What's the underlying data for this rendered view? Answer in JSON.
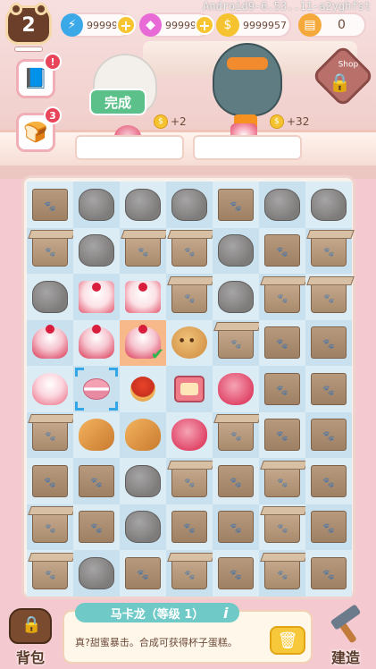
{
  "debug_text": "Android9-6.53..11-a2yghfst",
  "level": "2",
  "resources": {
    "gems": "9999986",
    "diamonds": "9999999",
    "coins": "9999957",
    "tickets": "0"
  },
  "side_buttons": {
    "book_badge": "!",
    "oven_badge": "3"
  },
  "order": {
    "done_label": "完成",
    "reward_left": "+2",
    "reward_right": "+32"
  },
  "shop_sign": "Shop",
  "board": {
    "rows": [
      [
        "box",
        "rock",
        "rock",
        "rock",
        "box",
        "rock",
        "rock"
      ],
      [
        "box-open",
        "rock",
        "box-open",
        "box-open",
        "rock",
        "box",
        "box-open"
      ],
      [
        "rock",
        "cake",
        "cake",
        "box-open",
        "rock",
        "box-open",
        "box-open"
      ],
      [
        "cupcake",
        "cupcake",
        "cupcake-sel",
        "cookie",
        "box-open",
        "box",
        "box"
      ],
      [
        "cupcake-wrap",
        "macaron-sel",
        "tart",
        "oven",
        "berrycake",
        "box",
        "box"
      ],
      [
        "box-open",
        "croissant",
        "croissant",
        "berrycake",
        "box-open",
        "box",
        "box"
      ],
      [
        "box",
        "box",
        "rock",
        "box-open",
        "box",
        "box-open",
        "box"
      ],
      [
        "box-open",
        "box",
        "rock",
        "box",
        "box",
        "box-open",
        "box"
      ],
      [
        "box-open",
        "rock",
        "box",
        "box-open",
        "box",
        "box-open",
        "box"
      ]
    ]
  },
  "bottom": {
    "bag_label": "背包",
    "build_label": "建造",
    "item_title": "马卡龙（等级 1）",
    "item_desc": "真?甜蜜暴击。合成可获得杯子蛋糕。"
  }
}
